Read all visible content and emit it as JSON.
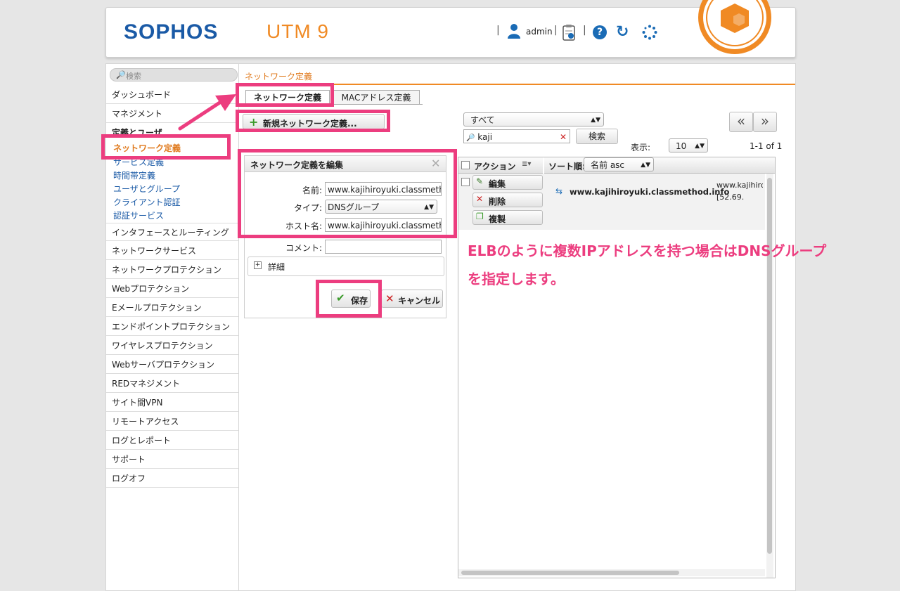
{
  "header": {
    "logo": "SOPHOS",
    "product": "UTM 9",
    "user": "admin",
    "sep": "|",
    "help": "?",
    "refresh": "↻"
  },
  "sidebar": {
    "search_placeholder": "検索",
    "items": [
      "ダッシュボード",
      "マネジメント",
      "定義とユーザ",
      "インタフェースとルーティング",
      "ネットワークサービス",
      "ネットワークプロテクション",
      "Webプロテクション",
      "Eメールプロテクション",
      "エンドポイントプロテクション",
      "ワイヤレスプロテクション",
      "Webサーバプロテクション",
      "REDマネジメント",
      "サイト間VPN",
      "リモートアクセス",
      "ログとレポート",
      "サポート",
      "ログオフ"
    ],
    "subitems": [
      "ネットワーク定義",
      "サービス定義",
      "時間帯定義",
      "ユーザとグループ",
      "クライアント認証",
      "認証サービス"
    ]
  },
  "content": {
    "breadcrumb": "ネットワーク定義",
    "tabs": [
      "ネットワーク定義",
      "MACアドレス定義"
    ],
    "new_button": "新規ネットワーク定義..."
  },
  "edit": {
    "title": "ネットワーク定義を編集",
    "name_label": "名前:",
    "name_value": "www.kajihiroyuki.classmetho",
    "type_label": "タイプ:",
    "type_value": "DNSグループ",
    "host_label": "ホスト名:",
    "host_value": "www.kajihiroyuki.classmetho",
    "comment_label": "コメント:",
    "comment_value": "",
    "details_label": "詳細",
    "save": "保存",
    "cancel": "キャンセル"
  },
  "list": {
    "filter": "すべて",
    "search_value": "kaji",
    "search_button": "検索",
    "display_label": "表示:",
    "page_size": "10",
    "range": "1-1 of 1",
    "prev": "«",
    "next": "»",
    "action_header": "アクション",
    "sort_label": "ソート順:",
    "sort_value": "名前 asc",
    "row": {
      "edit": "編集",
      "delete": "削除",
      "clone": "複製",
      "name": "www.kajihiroyuki.classmethod.info",
      "value1": "www.kajihirc",
      "value2": "[52.69."
    }
  },
  "annotation": {
    "line1": "ELBのように複数IPアドレスを持つ場合はDNSグループ",
    "line2": "を指定します。"
  },
  "colors": {
    "brand_blue": "#1a5aa6",
    "brand_orange": "#f08a24",
    "highlight": "#ec3d7f"
  }
}
